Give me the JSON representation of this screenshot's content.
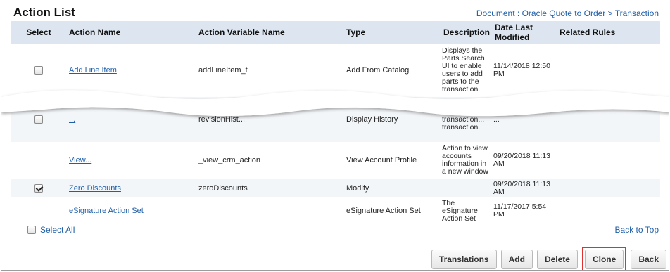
{
  "header": {
    "title": "Action List",
    "breadcrumb": "Document : Oracle Quote to Order > Transaction"
  },
  "table": {
    "columns": [
      "Select",
      "Action Name",
      "Action Variable Name",
      "Type",
      "Description",
      "Date Last Modified",
      "Related Rules"
    ],
    "rows": [
      {
        "checkbox": "unchecked",
        "name": "Add Line Item",
        "variable": "addLineItem_t",
        "type": "Add From Catalog",
        "description": "Displays the Parts Search UI to enable users to add parts to the transaction.",
        "date": "11/14/2018 12:50 PM",
        "rules": ""
      },
      {
        "checkbox": "unchecked",
        "name": "...",
        "variable": "revisionHist...",
        "type": "Display History",
        "description": "Transitions the transaction... transaction.",
        "date": "...",
        "rules": ""
      },
      {
        "checkbox": "none",
        "name": "View...",
        "variable": "_view_crm_action",
        "type": "View Account Profile",
        "description": "Action to view accounts information in a new window",
        "date": "09/20/2018 11:13 AM",
        "rules": ""
      },
      {
        "checkbox": "checked",
        "name": "Zero Discounts",
        "variable": "zeroDiscounts",
        "type": "Modify",
        "description": "",
        "date": "09/20/2018 11:13 AM",
        "rules": ""
      },
      {
        "checkbox": "none",
        "name": "eSignature Action Set",
        "variable": "",
        "type": "eSignature Action Set",
        "description": "The eSignature Action Set",
        "date": "11/17/2017 5:54 PM",
        "rules": ""
      }
    ]
  },
  "footer": {
    "select_all": "Select All",
    "back_to_top": "Back to Top"
  },
  "buttons": {
    "translations": "Translations",
    "add": "Add",
    "delete": "Delete",
    "clone": "Clone",
    "back": "Back"
  },
  "colors": {
    "link": "#1f5fa8",
    "header_bg": "#dde6f0",
    "highlight": "#e03030"
  }
}
